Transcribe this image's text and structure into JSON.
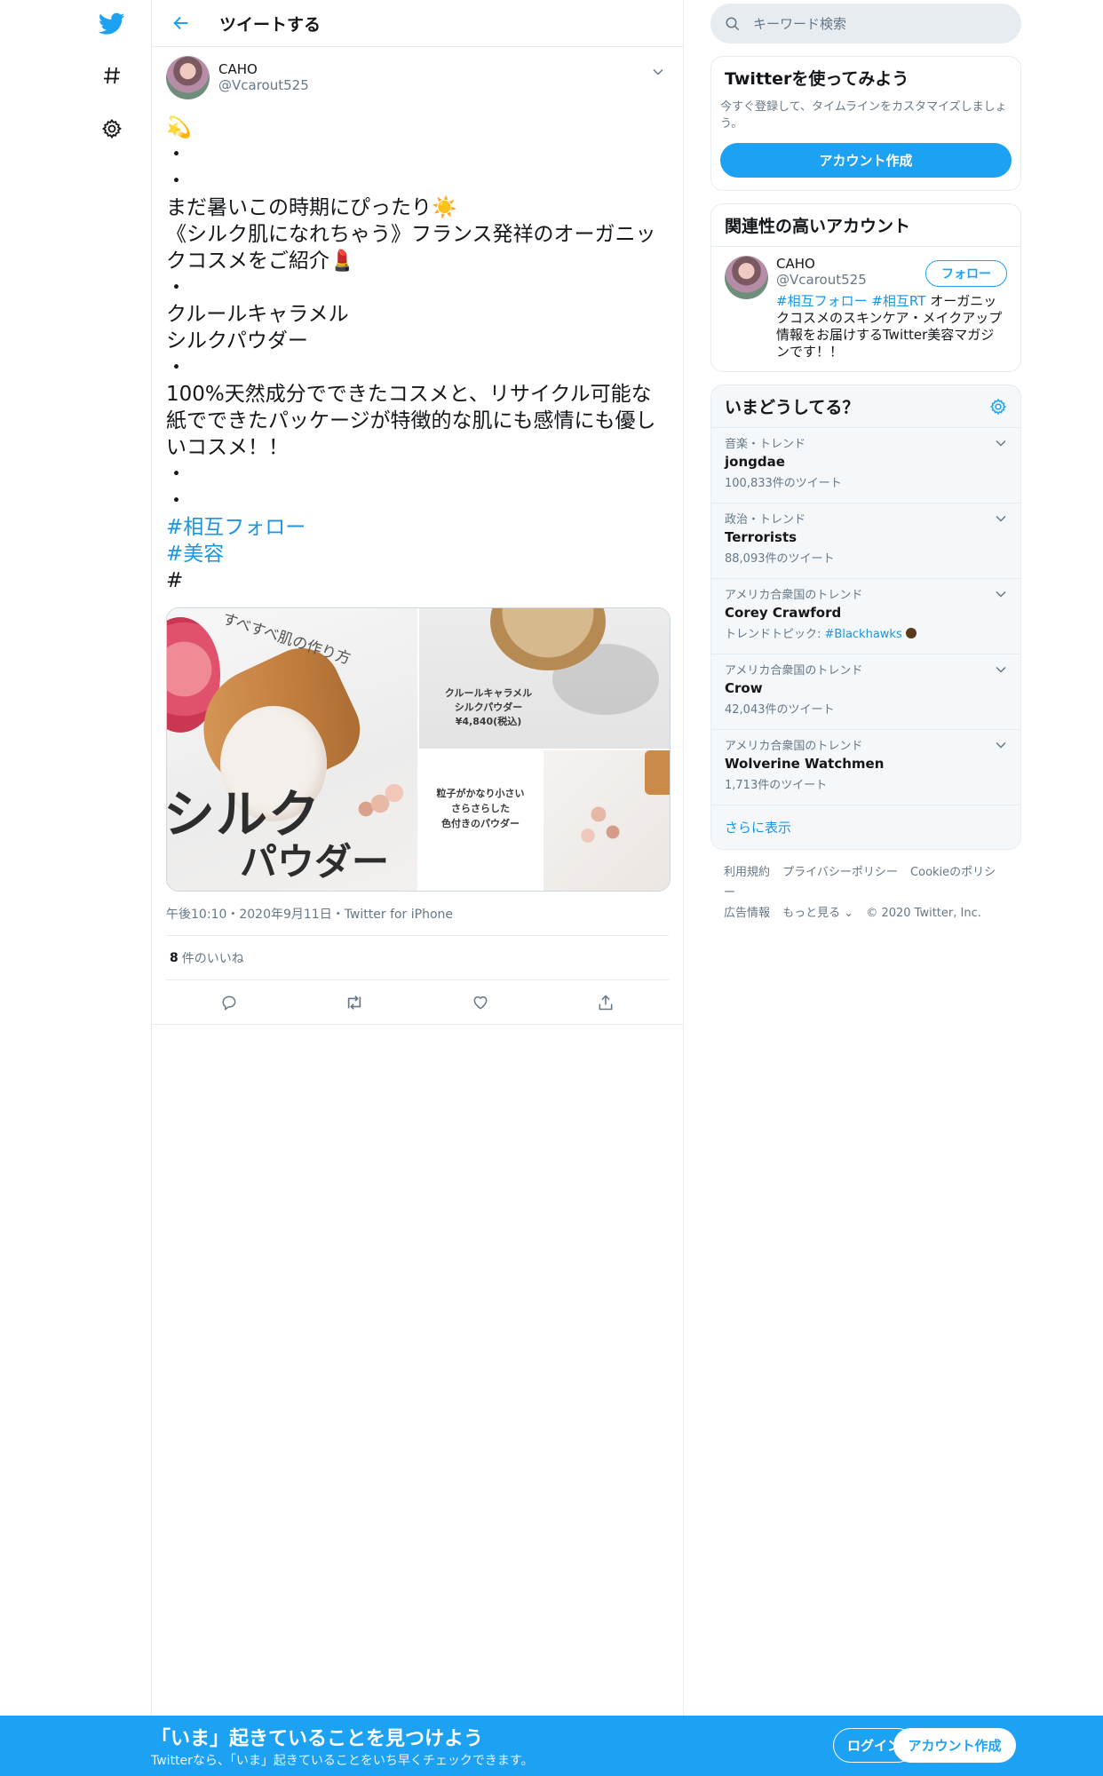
{
  "header": {
    "title": "ツイートする"
  },
  "tweet": {
    "author_name": "CAHO",
    "author_handle": "@Vcarout525",
    "lines": [
      "💫",
      "・",
      "・",
      "まだ暑いこの時期にぴったり☀️",
      "《シルク肌になれちゃう》フランス発祥のオーガニックコスメをご紹介💄",
      "・",
      "クルールキャラメル",
      "シルクパウダー",
      "・",
      "100%天然成分でできたコスメと、リサイクル可能な紙でできたパッケージが特徴的な肌にも感情にも優しいコスメ！！",
      "・",
      "・"
    ],
    "hashtags": [
      "#相互フォロー",
      "#美容"
    ],
    "trailing": "#",
    "media": {
      "curve_text": "すべすべ肌の作り方",
      "big_line1": "シルク",
      "big_line2": "パウダー",
      "tr_line1": "クルールキャラメル",
      "tr_line2": "シルクパウダー",
      "tr_line3": "¥4,840(税込)",
      "br_line1": "粒子がかなり小さい",
      "br_line2": "さらさらした",
      "br_line3": "色付きのパウダー"
    },
    "meta": "午後10:10・2020年9月11日・Twitter for iPhone",
    "likes_count": "8",
    "likes_label": "件のいいね"
  },
  "search": {
    "placeholder": "キーワード検索"
  },
  "signup_card": {
    "title": "Twitterを使ってみよう",
    "desc": "今すぐ登録して、タイムラインをカスタマイズしましょう。",
    "button": "アカウント作成"
  },
  "related": {
    "title": "関連性の高いアカウント",
    "name": "CAHO",
    "handle": "@Vcarout525",
    "follow_label": "フォロー",
    "bio_tag1": "#相互フォロー",
    "bio_tag2": "#相互RT",
    "bio_text": " オーガニックコスメのスキンケア・メイクアップ情報をお届けするTwitter美容マガジンです！！"
  },
  "trends": {
    "title": "いまどうしてる？",
    "items": [
      {
        "category": "音楽・トレンド",
        "name": "jongdae",
        "count": "100,833件のツイート"
      },
      {
        "category": "政治・トレンド",
        "name": "Terrorists",
        "count": "88,093件のツイート"
      },
      {
        "category": "アメリカ合衆国のトレンド",
        "name": "Corey Crawford",
        "topic_prefix": "トレンドトピック: ",
        "topic_tag": "#Blackhawks"
      },
      {
        "category": "アメリカ合衆国のトレンド",
        "name": "Crow",
        "count": "42,043件のツイート"
      },
      {
        "category": "アメリカ合衆国のトレンド",
        "name": "Wolverine Watchmen",
        "count": "1,713件のツイート"
      }
    ],
    "more": "さらに表示"
  },
  "footer": {
    "terms": "利用規約",
    "privacy": "プライバシーポリシー",
    "cookie": "Cookieのポリシー",
    "ads": "広告情報",
    "more": "もっと見る ⌄",
    "copyright": "© 2020 Twitter, Inc."
  },
  "bottom_bar": {
    "title": "「いま」起きていることを見つけよう",
    "subtitle": "Twitterなら、「いま」起きていることをいち早くチェックできます。",
    "login": "ログイン",
    "signup": "アカウント作成"
  },
  "colors": {
    "brand": "#1da1f2",
    "link": "#1b95e0",
    "muted": "#657786"
  }
}
